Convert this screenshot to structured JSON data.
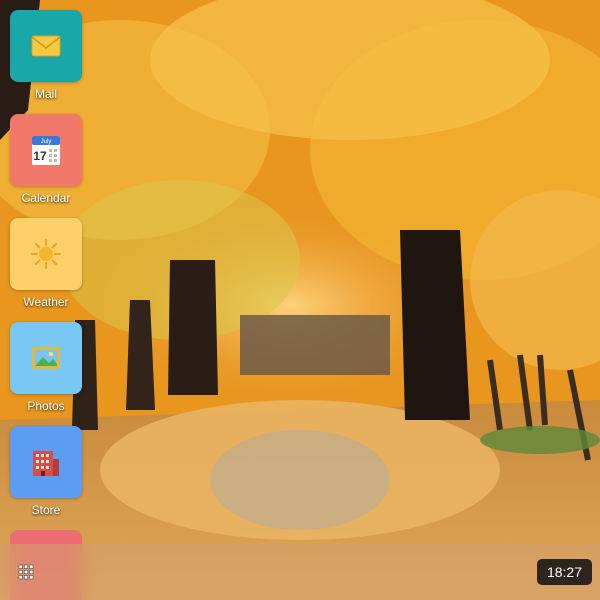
{
  "apps": [
    {
      "label": "Mail",
      "icon": "envelope-icon",
      "tile_color": "#1aa7a7"
    },
    {
      "label": "Calendar",
      "icon": "calendar-icon",
      "tile_color": "#f2786a",
      "calendar_month": "July",
      "calendar_day": "17"
    },
    {
      "label": "Weather",
      "icon": "sun-icon",
      "tile_color": "#ffd06a"
    },
    {
      "label": "Photos",
      "icon": "photo-icon",
      "tile_color": "#79c8f4"
    },
    {
      "label": "Store",
      "icon": "building-icon",
      "tile_color": "#5b9df2"
    }
  ],
  "taskbar": {
    "start_icon": "grid-icon",
    "clock": "18:27"
  }
}
